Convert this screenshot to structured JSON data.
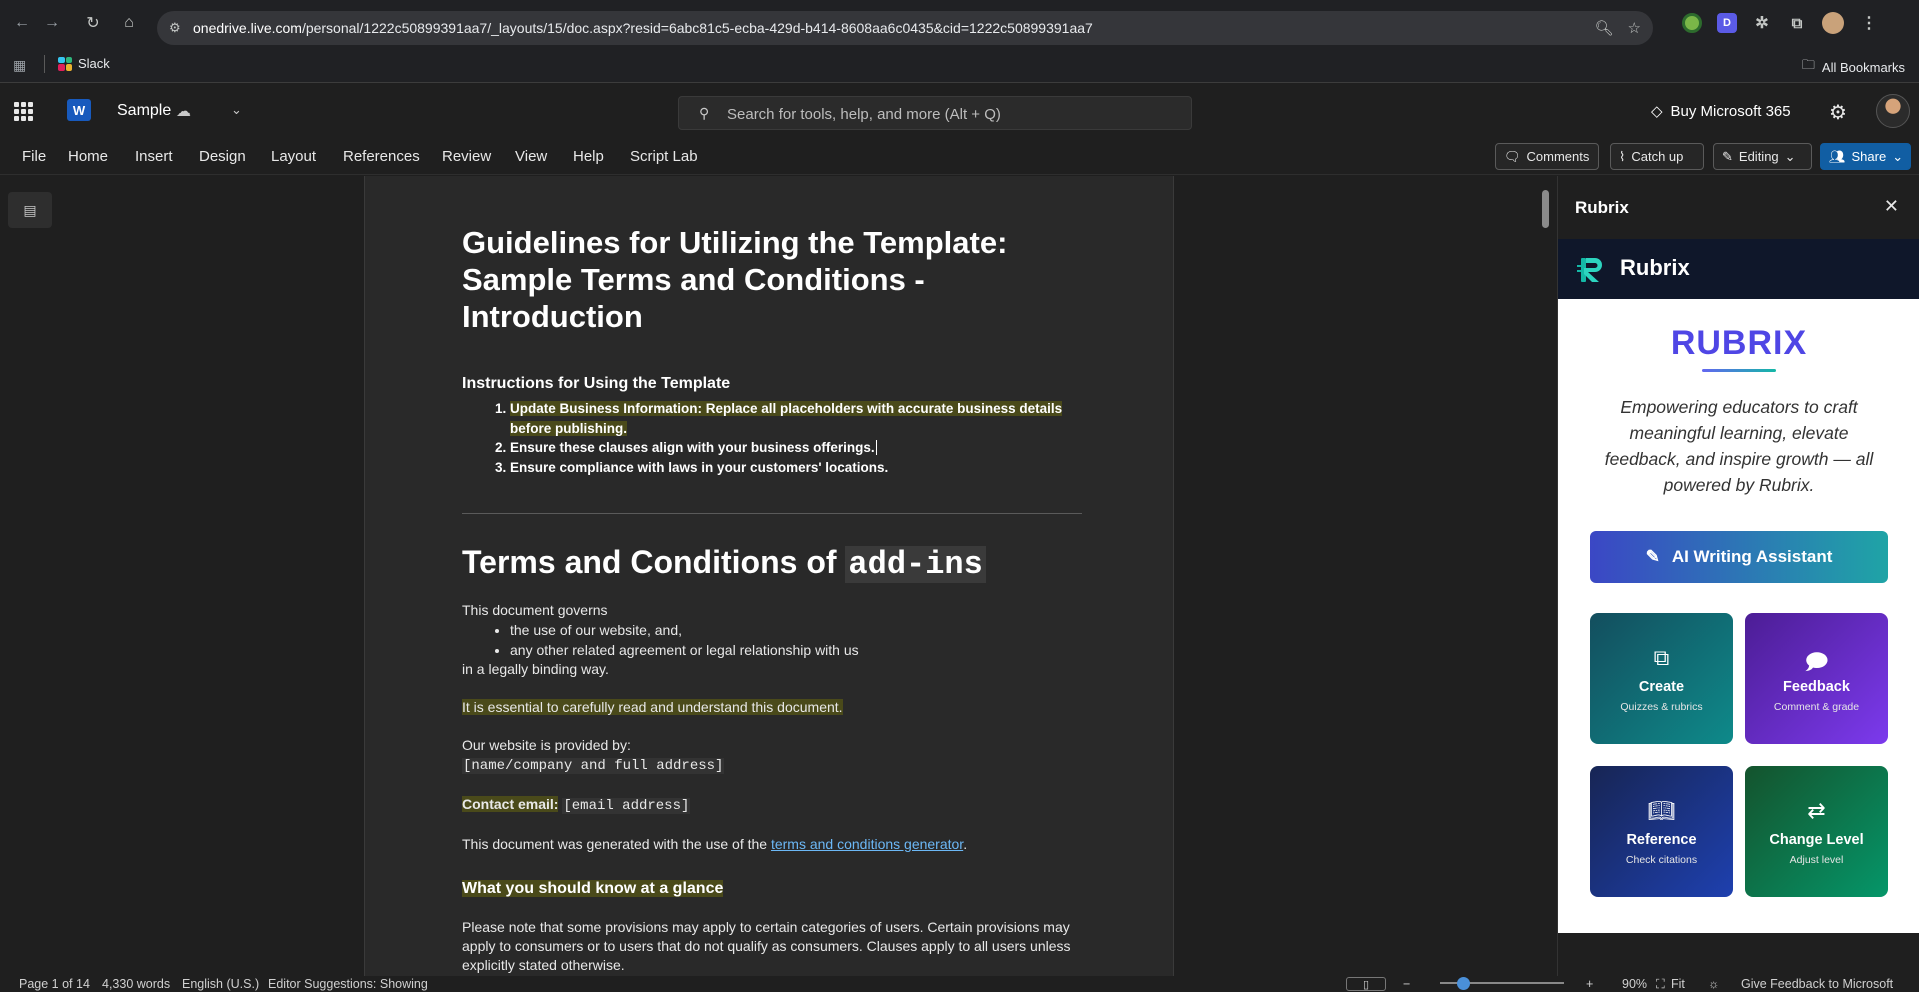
{
  "browser": {
    "url_domain": "onedrive.live.com",
    "url_path": "/personal/1222c50899391aa7/_layouts/15/doc.aspx?resid=6abc81c5-ecba-429d-b414-8608aa6c0435&cid=1222c50899391aa7",
    "bookmark_slack": "Slack",
    "all_bookmarks": "All Bookmarks",
    "ext_d": "D"
  },
  "app": {
    "word_logo": "W",
    "doc_title": "Sample",
    "search_placeholder": "Search for tools, help, and more (Alt + Q)",
    "buy_label": "Buy Microsoft 365"
  },
  "ribbon": {
    "tabs": [
      "File",
      "Home",
      "Insert",
      "Design",
      "Layout",
      "References",
      "Review",
      "View",
      "Help",
      "Script Lab"
    ],
    "comments": "Comments",
    "catch_up": "Catch up",
    "editing": "Editing",
    "share": "Share"
  },
  "document": {
    "title": "Guidelines for Utilizing the Template: Sample Terms and Conditions - Introduction",
    "instr_heading": "Instructions for Using the Template",
    "steps": [
      "Update Business Information: Replace all placeholders with accurate business details before publishing.",
      "Ensure these clauses align with your business offerings.",
      "Ensure compliance with laws in your customers' locations."
    ],
    "h2_text": "Terms and Conditions of ",
    "h2_code": "add-ins",
    "governs": "This document governs",
    "bullets": [
      "the use of our website, and,",
      "any other related agreement or legal relationship with us"
    ],
    "binding": "in a legally binding way.",
    "essential": "It is essential to carefully read and understand this document.",
    "provided_by": "Our website is provided by:",
    "name_placeholder": "[name/company and full address]",
    "contact_label": "Contact email:",
    "contact_placeholder": "[email address]",
    "generated_prefix": "This document was generated with the use of the ",
    "generated_link": "terms and conditions generator",
    "generated_suffix": ".",
    "glance_heading": "What you should know at a glance",
    "note": "Please note that some provisions may apply to certain categories of users. Certain provisions may apply to consumers or to users that do not qualify as consumers. Clauses apply to all users unless explicitly stated otherwise."
  },
  "panel": {
    "header": "Rubrix",
    "band_title": "Rubrix",
    "brand": "RUBRIX",
    "tagline": "Empowering educators to craft meaningful learning, elevate feedback, and inspire growth — all powered by Rubrix.",
    "ai_button": "AI Writing Assistant",
    "cards": [
      {
        "title": "Create",
        "sub": "Quizzes & rubrics",
        "icon": "create-icon"
      },
      {
        "title": "Feedback",
        "sub": "Comment & grade",
        "icon": "feedback-icon"
      },
      {
        "title": "Reference",
        "sub": "Check citations",
        "icon": "book-icon"
      },
      {
        "title": "Change Level",
        "sub": "Adjust level",
        "icon": "swap-icon"
      }
    ]
  },
  "status": {
    "page": "Page 1 of 14",
    "words": "4,330 words",
    "language": "English (U.S.)",
    "suggestions": "Editor Suggestions: Showing",
    "zoom": "90%",
    "fit": "Fit",
    "feedback": "Give Feedback to Microsoft"
  },
  "colors": {
    "accent": "#115ea3",
    "highlight": "#4a4a1a",
    "rubrix_indigo": "#4f46e5",
    "rubrix_teal": "#14b8a6"
  }
}
